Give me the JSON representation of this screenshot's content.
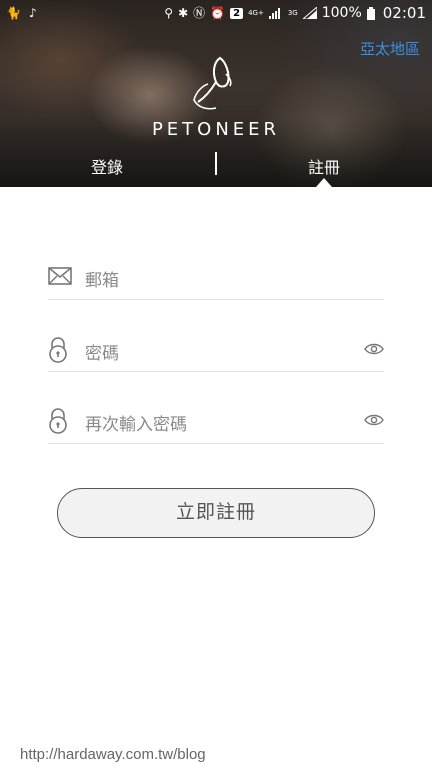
{
  "statusbar": {
    "battery_percent": "100%",
    "time": "02:01",
    "notification_count": "2",
    "network_4g": "4G+",
    "network_3g": "3G"
  },
  "header": {
    "region_link": "亞太地區",
    "brand": "PETONEER"
  },
  "tabs": {
    "login": "登錄",
    "register": "註冊",
    "active": "register"
  },
  "form": {
    "email_placeholder": "郵箱",
    "password_placeholder": "密碼",
    "confirm_password_placeholder": "再次輸入密碼",
    "submit_label": "立即註冊"
  },
  "watermark": "http://hardaway.com.tw/blog",
  "colors": {
    "region_link": "#3d8fe6",
    "field_divider": "#e2e2e2",
    "placeholder": "#8a8a8a"
  }
}
